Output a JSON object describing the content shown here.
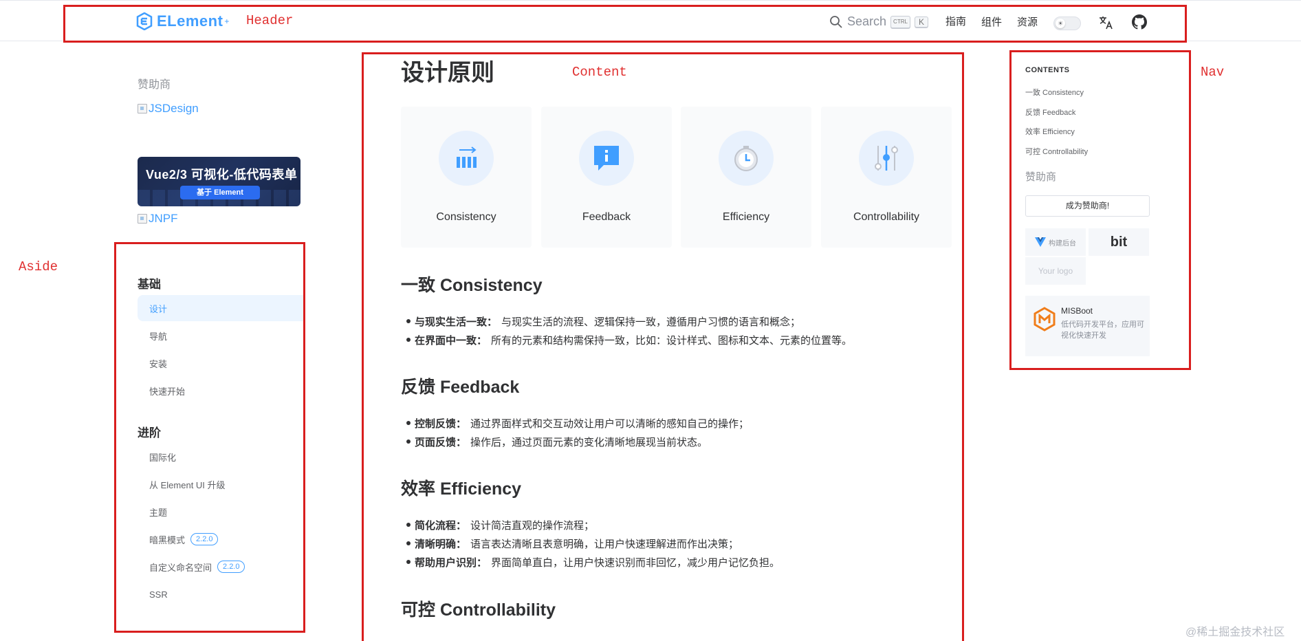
{
  "header": {
    "logo_text": "ELement",
    "logo_plus": "+",
    "search_label": "Search",
    "kbd_ctrl": "CTRL",
    "kbd_k": "K",
    "nav": [
      "指南",
      "组件",
      "资源"
    ],
    "toggle_icon": "sun-icon",
    "translate_icon": "translate-icon",
    "github_icon": "github-icon"
  },
  "annotations": {
    "header": "Header",
    "content": "Content",
    "nav": "Nav",
    "aside": "Aside"
  },
  "aside": {
    "sponsor_title": "赞助商",
    "img_jsdesign": "JSDesign",
    "banner_title": "Vue2/3 可视化-低代码表单",
    "banner_pill": "基于 Element",
    "img_jnpf": "JNPF",
    "groups": [
      {
        "title": "基础",
        "items": [
          {
            "label": "设计",
            "active": true
          },
          {
            "label": "导航"
          },
          {
            "label": "安装"
          },
          {
            "label": "快速开始"
          }
        ]
      },
      {
        "title": "进阶",
        "items": [
          {
            "label": "国际化"
          },
          {
            "label": "从 Element UI 升级"
          },
          {
            "label": "主题"
          },
          {
            "label": "暗黑模式",
            "badge": "2.2.0"
          },
          {
            "label": "自定义命名空间",
            "badge": "2.2.0"
          },
          {
            "label": "SSR"
          }
        ]
      }
    ]
  },
  "content": {
    "title": "设计原则",
    "cards": [
      {
        "label": "Consistency",
        "icon": "consistency-icon"
      },
      {
        "label": "Feedback",
        "icon": "feedback-icon"
      },
      {
        "label": "Efficiency",
        "icon": "efficiency-icon"
      },
      {
        "label": "Controllability",
        "icon": "controllability-icon"
      }
    ],
    "sections": [
      {
        "heading": "一致 Consistency",
        "bullets": [
          {
            "term": "与现实生活一致：",
            "text": "与现实生活的流程、逻辑保持一致，遵循用户习惯的语言和概念；"
          },
          {
            "term": "在界面中一致：",
            "text": "所有的元素和结构需保持一致，比如：设计样式、图标和文本、元素的位置等。"
          }
        ]
      },
      {
        "heading": "反馈 Feedback",
        "bullets": [
          {
            "term": "控制反馈：",
            "text": "通过界面样式和交互动效让用户可以清晰的感知自己的操作；"
          },
          {
            "term": "页面反馈：",
            "text": "操作后，通过页面元素的变化清晰地展现当前状态。"
          }
        ]
      },
      {
        "heading": "效率 Efficiency",
        "bullets": [
          {
            "term": "简化流程：",
            "text": "设计简洁直观的操作流程；"
          },
          {
            "term": "清晰明确：",
            "text": "语言表达清晰且表意明确，让用户快速理解进而作出决策；"
          },
          {
            "term": "帮助用户识别：",
            "text": "界面简单直白，让用户快速识别而非回忆，减少用户记忆负担。"
          }
        ]
      },
      {
        "heading": "可控 Controllability",
        "bullets": []
      }
    ]
  },
  "toc": {
    "title": "CONTENTS",
    "items": [
      "一致 Consistency",
      "反馈 Feedback",
      "效率 Efficiency",
      "可控 Controllability"
    ],
    "sponsor_title": "赞助商",
    "become_button": "成为赞助商!",
    "logos": [
      "构建后台",
      "bit",
      "Your logo"
    ],
    "misboot_name": "MISBoot",
    "misboot_desc": "低代码开发平台，应用可视化快速开发"
  },
  "watermark": "@稀土掘金技术社区",
  "colors": {
    "accent": "#409eff",
    "annotation": "#d91e1e"
  }
}
